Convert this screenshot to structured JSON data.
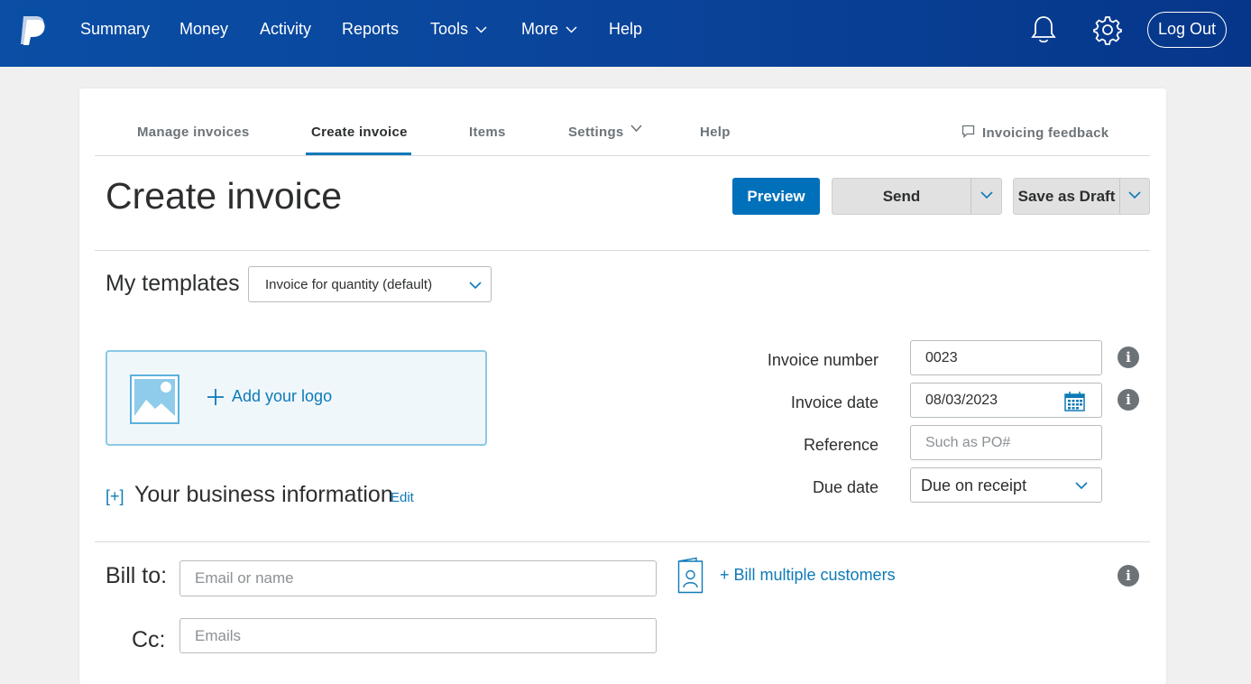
{
  "topnav": {
    "items": [
      "Summary",
      "Money",
      "Activity",
      "Reports",
      "Tools",
      "More",
      "Help"
    ],
    "logout_label": "Log Out",
    "icons": [
      "paypal-logo",
      "bell-icon",
      "gear-icon"
    ]
  },
  "subnav": {
    "tabs": [
      "Manage invoices",
      "Create invoice",
      "Items",
      "Settings",
      "Help"
    ],
    "active": "Create invoice",
    "feedback_label": "Invoicing feedback"
  },
  "header": {
    "title": "Create invoice",
    "preview_label": "Preview",
    "send_label": "Send",
    "save_draft_label": "Save as Draft"
  },
  "templates": {
    "label": "My templates",
    "selected": "Invoice for quantity (default)"
  },
  "logo": {
    "add_label": "Add your logo"
  },
  "business": {
    "toggle": "[+]",
    "title": "Your business information",
    "edit_label": "Edit"
  },
  "invoice_fields": {
    "number_label": "Invoice number",
    "number_value": "0023",
    "date_label": "Invoice date",
    "date_value": "08/03/2023",
    "reference_label": "Reference",
    "reference_placeholder": "Such as PO#",
    "due_label": "Due date",
    "due_value": "Due on receipt"
  },
  "billing": {
    "bill_to_label": "Bill to:",
    "bill_to_placeholder": "Email or name",
    "cc_label": "Cc:",
    "cc_placeholder": "Emails",
    "bill_multiple_label": "+ Bill multiple customers"
  },
  "colors": {
    "topbar": "#0a4ea5",
    "accent": "#0070ba",
    "link": "#0e7ab8"
  }
}
